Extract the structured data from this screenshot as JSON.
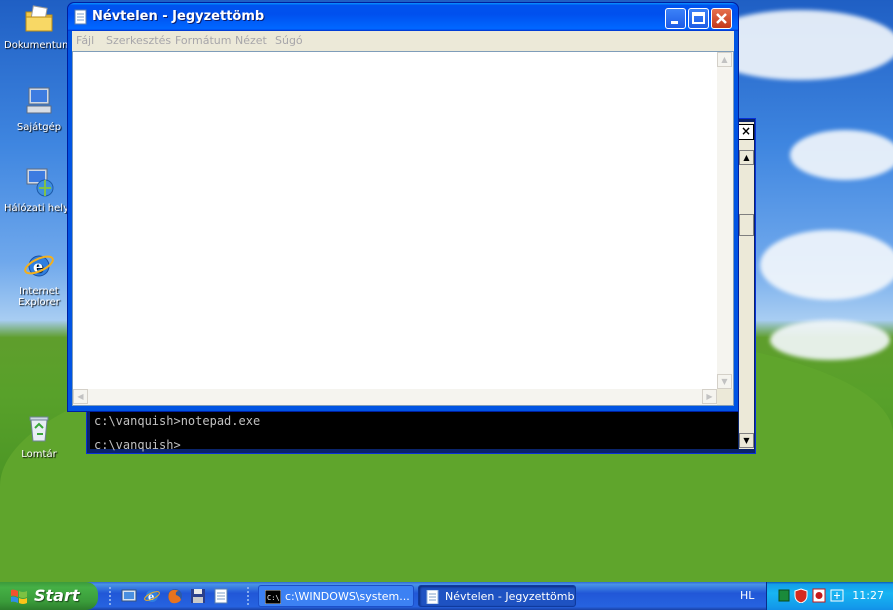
{
  "desktop": {
    "icons": [
      {
        "label": "Dokumentumok",
        "icon": "folder-documents-icon"
      },
      {
        "label": "Sajátgép",
        "icon": "my-computer-icon"
      },
      {
        "label": "Hálózati helyek",
        "icon": "network-places-icon"
      },
      {
        "label": "Internet Explorer",
        "icon": "internet-explorer-icon"
      },
      {
        "label": "Lomtár",
        "icon": "recycle-bin-icon"
      }
    ]
  },
  "console": {
    "lines": [
      "c:\\vanquish>notepad.exe",
      "c:\\vanquish>"
    ]
  },
  "notepad": {
    "title": "Névtelen - Jegyzettömb",
    "menu": [
      "Fájl",
      "Szerkesztés",
      "Formátum",
      "Nézet",
      "Súgó"
    ],
    "content": ""
  },
  "taskbar": {
    "start_label": "Start",
    "quick_launch": [
      "show-desktop-icon",
      "internet-explorer-icon",
      "firefox-icon",
      "save-icon",
      "notepad-icon"
    ],
    "buttons": [
      {
        "label": "c:\\WINDOWS\\system...",
        "icon": "console-icon",
        "active": false
      },
      {
        "label": "Névtelen - Jegyzettömb",
        "icon": "notepad-icon",
        "active": true
      }
    ],
    "language": "HL",
    "clock": "11:27"
  },
  "colors": {
    "title_blue": "#0054e3",
    "taskbar_blue": "#245edb",
    "start_green": "#3a9c3a",
    "tray_blue": "#139ee9"
  }
}
